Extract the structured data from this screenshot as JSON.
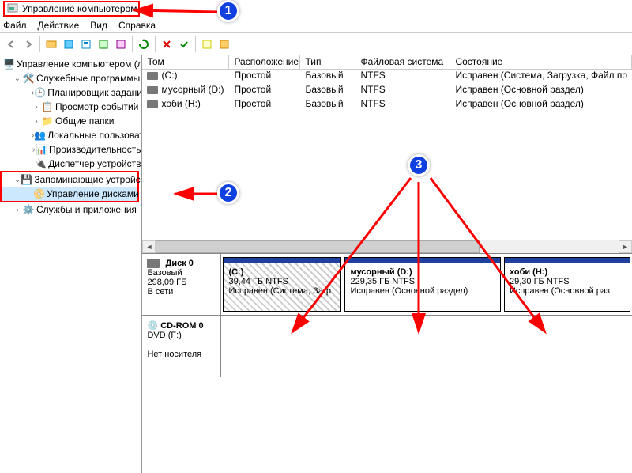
{
  "window": {
    "title": "Управление компьютером"
  },
  "menus": [
    "Файл",
    "Действие",
    "Вид",
    "Справка"
  ],
  "tree": {
    "root": "Управление компьютером (л",
    "groups": [
      {
        "label": "Служебные программы",
        "children": [
          "Планировщик заданий",
          "Просмотр событий",
          "Общие папки",
          "Локальные пользовате",
          "Производительность",
          "Диспетчер устройств"
        ]
      },
      {
        "label": "Запоминающие устройст",
        "children": [
          "Управление дисками"
        ]
      },
      {
        "label": "Службы и приложения",
        "children": []
      }
    ]
  },
  "vol_columns": [
    "Том",
    "Расположение",
    "Тип",
    "Файловая система",
    "Состояние"
  ],
  "volumes": [
    {
      "name": "(C:)",
      "layout": "Простой",
      "type": "Базовый",
      "fs": "NTFS",
      "state": "Исправен (Система, Загрузка, Файл по"
    },
    {
      "name": "мусорный (D:)",
      "layout": "Простой",
      "type": "Базовый",
      "fs": "NTFS",
      "state": "Исправен (Основной раздел)"
    },
    {
      "name": "хоби (H:)",
      "layout": "Простой",
      "type": "Базовый",
      "fs": "NTFS",
      "state": "Исправен (Основной раздел)"
    }
  ],
  "disks": [
    {
      "label": "Диск 0",
      "type": "Базовый",
      "size": "298,09 ГБ",
      "status": "В сети",
      "parts": [
        {
          "name": "(C:)",
          "size": "39,44 ГБ NTFS",
          "state": "Исправен (Система, Загр",
          "hatched": true
        },
        {
          "name": "мусорный (D:)",
          "size": "229,35 ГБ NTFS",
          "state": "Исправен (Основной раздел)",
          "hatched": false
        },
        {
          "name": "хоби (H:)",
          "size": "29,30 ГБ NTFS",
          "state": "Исправен (Основной раз",
          "hatched": false
        }
      ]
    },
    {
      "label": "CD-ROM 0",
      "type": "DVD (F:)",
      "size": "",
      "status": "Нет носителя",
      "parts": []
    }
  ],
  "annotations": {
    "b1": "1",
    "b2": "2",
    "b3": "3"
  }
}
